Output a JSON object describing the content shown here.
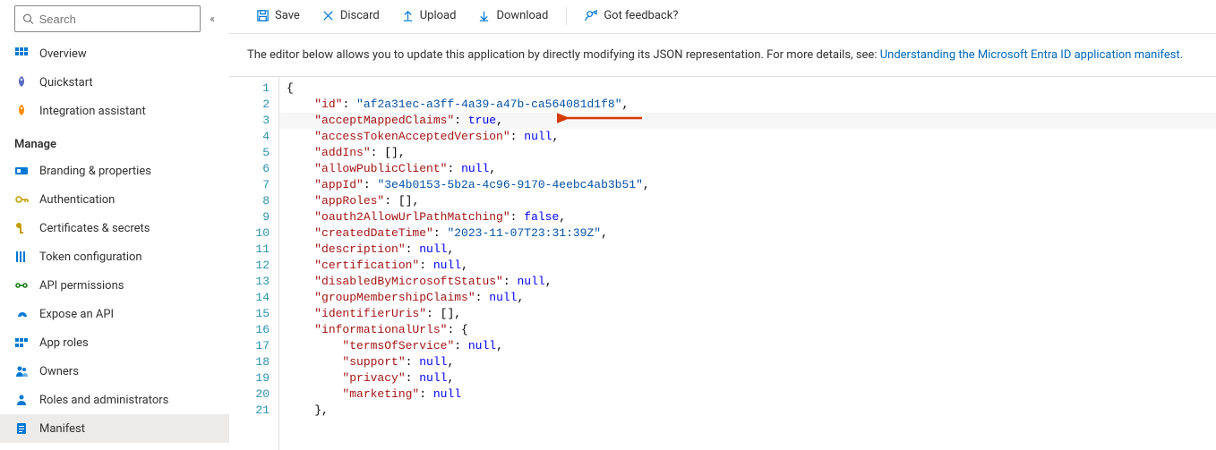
{
  "sidebar": {
    "search_placeholder": "Search",
    "groups": [
      {
        "items": [
          {
            "label": "Overview",
            "icon": "grid"
          },
          {
            "label": "Quickstart",
            "icon": "rocket"
          },
          {
            "label": "Integration assistant",
            "icon": "rocket-orange"
          }
        ]
      },
      {
        "heading": "Manage",
        "items": [
          {
            "label": "Branding & properties",
            "icon": "brand"
          },
          {
            "label": "Authentication",
            "icon": "auth"
          },
          {
            "label": "Certificates & secrets",
            "icon": "key"
          },
          {
            "label": "Token configuration",
            "icon": "token"
          },
          {
            "label": "API permissions",
            "icon": "api-perm"
          },
          {
            "label": "Expose an API",
            "icon": "expose"
          },
          {
            "label": "App roles",
            "icon": "approles"
          },
          {
            "label": "Owners",
            "icon": "owners"
          },
          {
            "label": "Roles and administrators",
            "icon": "roles"
          },
          {
            "label": "Manifest",
            "icon": "manifest",
            "selected": true
          }
        ]
      }
    ]
  },
  "toolbar": {
    "save": "Save",
    "discard": "Discard",
    "upload": "Upload",
    "download": "Download",
    "feedback": "Got feedback?"
  },
  "info": {
    "text": "The editor below allows you to update this application by directly modifying its JSON representation. For more details, see: ",
    "link": "Understanding the Microsoft Entra ID application manifest."
  },
  "editor": {
    "lines": [
      {
        "n": 1,
        "indent": 0,
        "tokens": [
          [
            "punc",
            "{"
          ]
        ]
      },
      {
        "n": 2,
        "indent": 1,
        "tokens": [
          [
            "key",
            "\"id\""
          ],
          [
            "punc",
            ": "
          ],
          [
            "str",
            "\"af2a31ec-a3ff-4a39-a47b-ca564081d1f8\""
          ],
          [
            "punc",
            ","
          ]
        ]
      },
      {
        "n": 3,
        "indent": 1,
        "hl": true,
        "tokens": [
          [
            "key",
            "\"acceptMappedClaims\""
          ],
          [
            "punc",
            ": "
          ],
          [
            "bool",
            "true"
          ],
          [
            "punc",
            ","
          ]
        ]
      },
      {
        "n": 4,
        "indent": 1,
        "tokens": [
          [
            "key",
            "\"accessTokenAcceptedVersion\""
          ],
          [
            "punc",
            ": "
          ],
          [
            "null",
            "null"
          ],
          [
            "punc",
            ","
          ]
        ]
      },
      {
        "n": 5,
        "indent": 1,
        "tokens": [
          [
            "key",
            "\"addIns\""
          ],
          [
            "punc",
            ": []"
          ],
          [
            "punc",
            ","
          ]
        ]
      },
      {
        "n": 6,
        "indent": 1,
        "tokens": [
          [
            "key",
            "\"allowPublicClient\""
          ],
          [
            "punc",
            ": "
          ],
          [
            "null",
            "null"
          ],
          [
            "punc",
            ","
          ]
        ]
      },
      {
        "n": 7,
        "indent": 1,
        "tokens": [
          [
            "key",
            "\"appId\""
          ],
          [
            "punc",
            ": "
          ],
          [
            "str",
            "\"3e4b0153-5b2a-4c96-9170-4eebc4ab3b51\""
          ],
          [
            "punc",
            ","
          ]
        ]
      },
      {
        "n": 8,
        "indent": 1,
        "tokens": [
          [
            "key",
            "\"appRoles\""
          ],
          [
            "punc",
            ": []"
          ],
          [
            "punc",
            ","
          ]
        ]
      },
      {
        "n": 9,
        "indent": 1,
        "tokens": [
          [
            "key",
            "\"oauth2AllowUrlPathMatching\""
          ],
          [
            "punc",
            ": "
          ],
          [
            "bool",
            "false"
          ],
          [
            "punc",
            ","
          ]
        ]
      },
      {
        "n": 10,
        "indent": 1,
        "tokens": [
          [
            "key",
            "\"createdDateTime\""
          ],
          [
            "punc",
            ": "
          ],
          [
            "str",
            "\"2023-11-07T23:31:39Z\""
          ],
          [
            "punc",
            ","
          ]
        ]
      },
      {
        "n": 11,
        "indent": 1,
        "tokens": [
          [
            "key",
            "\"description\""
          ],
          [
            "punc",
            ": "
          ],
          [
            "null",
            "null"
          ],
          [
            "punc",
            ","
          ]
        ]
      },
      {
        "n": 12,
        "indent": 1,
        "tokens": [
          [
            "key",
            "\"certification\""
          ],
          [
            "punc",
            ": "
          ],
          [
            "null",
            "null"
          ],
          [
            "punc",
            ","
          ]
        ]
      },
      {
        "n": 13,
        "indent": 1,
        "tokens": [
          [
            "key",
            "\"disabledByMicrosoftStatus\""
          ],
          [
            "punc",
            ": "
          ],
          [
            "null",
            "null"
          ],
          [
            "punc",
            ","
          ]
        ]
      },
      {
        "n": 14,
        "indent": 1,
        "tokens": [
          [
            "key",
            "\"groupMembershipClaims\""
          ],
          [
            "punc",
            ": "
          ],
          [
            "null",
            "null"
          ],
          [
            "punc",
            ","
          ]
        ]
      },
      {
        "n": 15,
        "indent": 1,
        "tokens": [
          [
            "key",
            "\"identifierUris\""
          ],
          [
            "punc",
            ": []"
          ],
          [
            "punc",
            ","
          ]
        ]
      },
      {
        "n": 16,
        "indent": 1,
        "tokens": [
          [
            "key",
            "\"informationalUrls\""
          ],
          [
            "punc",
            ": {"
          ]
        ]
      },
      {
        "n": 17,
        "indent": 2,
        "tokens": [
          [
            "key",
            "\"termsOfService\""
          ],
          [
            "punc",
            ": "
          ],
          [
            "null",
            "null"
          ],
          [
            "punc",
            ","
          ]
        ]
      },
      {
        "n": 18,
        "indent": 2,
        "tokens": [
          [
            "key",
            "\"support\""
          ],
          [
            "punc",
            ": "
          ],
          [
            "null",
            "null"
          ],
          [
            "punc",
            ","
          ]
        ]
      },
      {
        "n": 19,
        "indent": 2,
        "tokens": [
          [
            "key",
            "\"privacy\""
          ],
          [
            "punc",
            ": "
          ],
          [
            "null",
            "null"
          ],
          [
            "punc",
            ","
          ]
        ]
      },
      {
        "n": 20,
        "indent": 2,
        "tokens": [
          [
            "key",
            "\"marketing\""
          ],
          [
            "punc",
            ": "
          ],
          [
            "null",
            "null"
          ]
        ]
      },
      {
        "n": 21,
        "indent": 1,
        "tokens": [
          [
            "punc",
            "},"
          ]
        ]
      }
    ]
  }
}
